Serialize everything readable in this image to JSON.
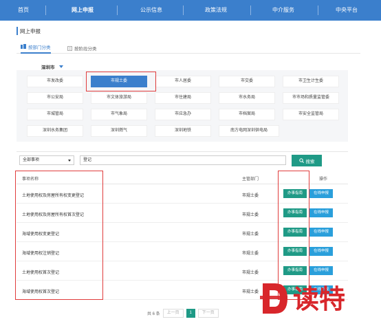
{
  "nav": {
    "items": [
      "首页",
      "网上申报",
      "公示信息",
      "政策法规",
      "中介服务",
      "中央平台"
    ],
    "active_index": 1
  },
  "page": {
    "title": "网上申报"
  },
  "tabs": [
    {
      "label": "按部门分类",
      "active": true
    },
    {
      "label": "按阶段分类",
      "active": false
    }
  ],
  "city": {
    "label": "深圳市"
  },
  "departments": [
    [
      "市发改委",
      "市规土委",
      "市人居委",
      "市交委",
      "市卫生计生委"
    ],
    [
      "市公安局",
      "市文体旅游局",
      "市住建局",
      "市水务局",
      "市市场和质量监管委"
    ],
    [
      "市城管局",
      "市气象局",
      "市应急办",
      "市档案局",
      "市安全监管局"
    ],
    [
      "深圳水务集团",
      "深圳燃气",
      "深圳地铁",
      "南方电网深圳供电局"
    ]
  ],
  "selected_department": "市规土委",
  "filter": {
    "select_value": "全部事项",
    "search_value": "登记",
    "search_button": "搜索"
  },
  "table": {
    "headers": {
      "name": "事项名称",
      "dept": "主管部门",
      "ops": "操作"
    },
    "rows": [
      {
        "name": "土地使用权及房屋所有权变更登记",
        "dept": "市规土委"
      },
      {
        "name": "土地使用权及房屋所有权首次登记",
        "dept": "市规土委"
      },
      {
        "name": "海域使用权变更登记",
        "dept": "市规土委"
      },
      {
        "name": "海域使用权注销登记",
        "dept": "市规土委"
      },
      {
        "name": "土地使用权首次登记",
        "dept": "市规土委"
      },
      {
        "name": "海域使用权首次登记",
        "dept": "市规土委"
      }
    ],
    "guide_label": "办事指南",
    "apply_label": "在线申报"
  },
  "pager": {
    "total": "共 6 条",
    "prev": "上一页",
    "current": "1",
    "next": "下一页"
  },
  "watermark": {
    "text": "读特",
    "color": "#d8262b"
  }
}
